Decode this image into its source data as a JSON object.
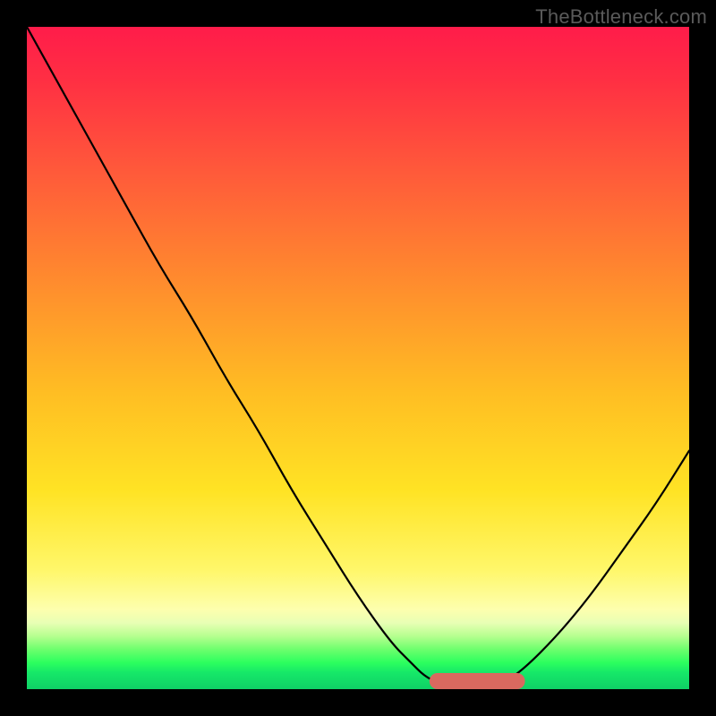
{
  "watermark": "TheBottleneck.com",
  "chart_data": {
    "type": "line",
    "title": "",
    "xlabel": "",
    "ylabel": "",
    "xlim": [
      0,
      100
    ],
    "ylim": [
      0,
      100
    ],
    "grid": false,
    "legend": false,
    "x": [
      0,
      5,
      10,
      15,
      20,
      25,
      30,
      35,
      40,
      45,
      50,
      55,
      58,
      60,
      62,
      65,
      68,
      70,
      72,
      75,
      80,
      85,
      90,
      95,
      100
    ],
    "series": [
      {
        "name": "bottleneck-curve",
        "color": "#000000",
        "values": [
          100,
          91,
          82,
          73,
          64,
          56,
          47,
          39,
          30,
          22,
          14,
          7,
          4,
          2,
          1,
          0,
          0,
          0,
          1,
          3,
          8,
          14,
          21,
          28,
          36
        ]
      }
    ],
    "optimal_range": {
      "start": 62,
      "end": 74,
      "color": "#d9695f"
    },
    "background_gradient": {
      "stops": [
        {
          "pos": 0.0,
          "color": "#ff1c4a"
        },
        {
          "pos": 0.22,
          "color": "#ff5a3a"
        },
        {
          "pos": 0.55,
          "color": "#ffbd23"
        },
        {
          "pos": 0.82,
          "color": "#fff76a"
        },
        {
          "pos": 0.92,
          "color": "#b6ff8f"
        },
        {
          "pos": 1.0,
          "color": "#0fd066"
        }
      ]
    }
  }
}
